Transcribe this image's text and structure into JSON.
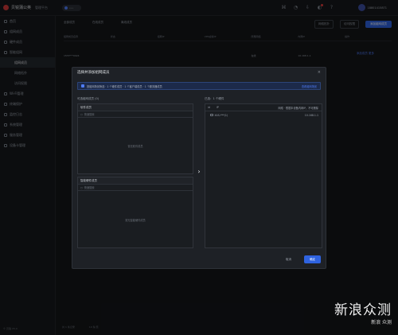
{
  "app": {
    "name": "贝锐蒲公英",
    "subtitle": "管理平台",
    "project_chip": "•••"
  },
  "user": {
    "name": "18801415871"
  },
  "sidebar": {
    "items": [
      {
        "label": "首页",
        "type": "top",
        "active": false
      },
      {
        "label": "组网成员",
        "type": "top",
        "active": false
      },
      {
        "label": "硬件成员",
        "type": "top",
        "active": false
      },
      {
        "label": "智能组网",
        "type": "top",
        "active": false
      },
      {
        "label": "组网成员",
        "type": "sub",
        "active": true
      },
      {
        "label": "网络拓扑",
        "type": "sub",
        "active": false
      },
      {
        "label": "访问权限",
        "type": "sub",
        "active": false
      },
      {
        "label": "Wi-Fi管理",
        "type": "top",
        "active": false
      },
      {
        "label": "终端保护",
        "type": "top",
        "active": false
      },
      {
        "label": "监控日志",
        "type": "top",
        "active": false
      },
      {
        "label": "系统管理",
        "type": "top",
        "active": false
      },
      {
        "label": "服务管理",
        "type": "top",
        "active": false
      },
      {
        "label": "设备卡管理",
        "type": "top",
        "active": false
      }
    ],
    "footer": "© 贝锐 V5.0"
  },
  "main": {
    "tabs": [
      "全部成员",
      "在线成员",
      "离线成员"
    ],
    "right_buttons": {
      "a": "网络拓扑",
      "b": "访问权限",
      "primary": "添加组网成员"
    },
    "columns": [
      "组网成员名称",
      "状态",
      "组网IP",
      "VPN虚拟IP",
      "所属网络",
      "内网IP",
      "操作"
    ],
    "row": [
      "15TP***0024",
      "",
      "",
      "",
      "在线",
      "10.168.1.1",
      ""
    ],
    "row_links": [
      "添加成员",
      "更多"
    ],
    "pager": [
      "共 1 条记录",
      "10 条/页"
    ]
  },
  "modal": {
    "title": "选择并添加组网成员",
    "notice": "按组网场景筛选  · 1 个硬件成员  · 1 个客户端成员  · 1 个服务器成员",
    "notice_link": "查看组网场景",
    "left_title": "可选组网成员 (0)",
    "section_software": {
      "title": "软件成员",
      "search_placeholder": "快速搜索",
      "empty": "暂无软件成员"
    },
    "section_hardware": {
      "title": "智能硬件成员",
      "search_placeholder": "快速搜索",
      "empty": "暂无智能硬件成员"
    },
    "right_title": "已选：1 个硬件",
    "right_header": {
      "col1": "id",
      "col2": "IP",
      "end": "网络 · 根据本设备内网IP，不可删除"
    },
    "selected_items": [
      {
        "name": "X4S-***(1)",
        "ip": "10.168.1.1"
      }
    ],
    "cancel": "取消",
    "ok": "确定"
  },
  "watermark": {
    "main": "新浪众测",
    "sub": "新浪 众测"
  }
}
